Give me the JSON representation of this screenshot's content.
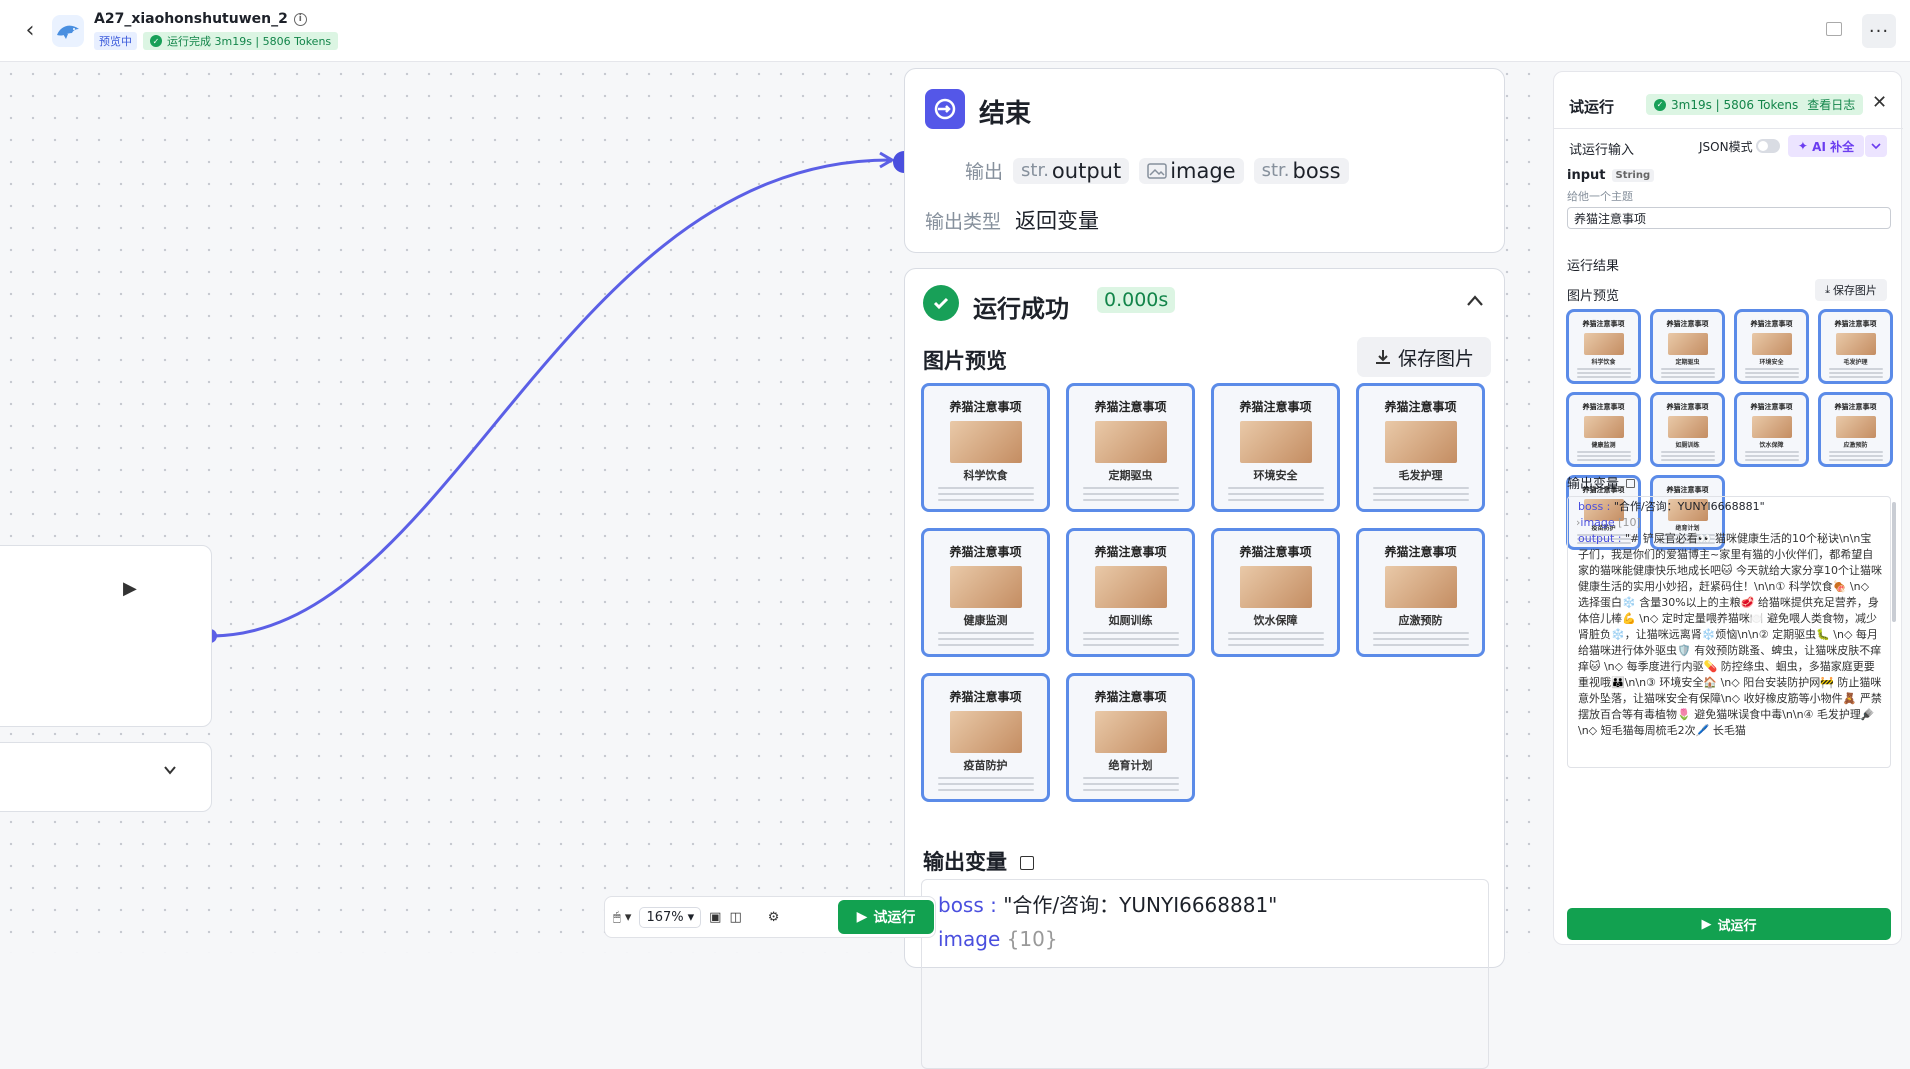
{
  "header": {
    "title": "A27_xiaohonshutuwen_2",
    "badge_preview": "预览中",
    "status": "运行完成 3m19s | 5806 Tokens"
  },
  "end_node": {
    "title": "结束",
    "output_label": "输出",
    "outputs": [
      {
        "type": "str.",
        "name": "output"
      },
      {
        "type": "img",
        "name": "image"
      },
      {
        "type": "str.",
        "name": "boss"
      }
    ],
    "output_type_label": "输出类型",
    "output_type_value": "返回变量"
  },
  "run_node": {
    "title": "运行成功",
    "time": "0.000s",
    "image_preview": "图片预览",
    "save_button": "保存图片",
    "output_vars": "输出变量",
    "boss_key": "boss",
    "boss_value": "\"合作/咨询：YUNYI6668881\"",
    "image_key": "image",
    "image_count": "{10}"
  },
  "images": [
    {
      "title": "养猫注意事项",
      "caption": "科学饮食"
    },
    {
      "title": "养猫注意事项",
      "caption": "定期驱虫"
    },
    {
      "title": "养猫注意事项",
      "caption": "环境安全"
    },
    {
      "title": "养猫注意事项",
      "caption": "毛发护理"
    },
    {
      "title": "养猫注意事项",
      "caption": "健康监测"
    },
    {
      "title": "养猫注意事项",
      "caption": "如厕训练"
    },
    {
      "title": "养猫注意事项",
      "caption": "饮水保障"
    },
    {
      "title": "养猫注意事项",
      "caption": "应激预防"
    },
    {
      "title": "养猫注意事项",
      "caption": "疫苗防护"
    },
    {
      "title": "养猫注意事项",
      "caption": "绝育计划"
    }
  ],
  "toolbar": {
    "zoom": "167%",
    "run": "试运行"
  },
  "panel": {
    "title": "试运行",
    "status": "3m19s | 5806 Tokens",
    "view_log": "查看日志",
    "input_section": "试运行输入",
    "json_mode": "JSON模式",
    "ai_button": "AI 补全",
    "input_name": "input",
    "input_type": "String",
    "input_hint": "给他一个主题",
    "input_value": "养猫注意事项",
    "result_section": "运行结果",
    "image_preview": "图片预览",
    "save_button": "保存图片",
    "output_vars": "输出变量",
    "boss_key": "boss",
    "boss_value": "\"合作/咨询：YUNYI6668881\"",
    "image_key": "image",
    "image_count": "[10]",
    "output_key": "output",
    "output_value": "\"# 铲屎官必看👀 猫咪健康生活的10个秘诀\\n\\n宝子们，我是你们的爱猫博主~家里有猫的小伙伴们，都希望自家的猫咪能健康快乐地成长吧🐱 今天就给大家分享10个让猫咪健康生活的实用小妙招，赶紧码住！\\n\\n① 科学饮食🍖 \\n◇ 选择蛋白❄️ 含量30%以上的主粮🥩 给猫咪提供充足营养，身体倍儿棒💪 \\n◇ 定时定量喂养猫咪🍽️ 避免喂人类食物，减少肾脏负❄️，让猫咪远离肾❄️烦恼\\n\\n② 定期驱虫🐛 \\n◇ 每月给猫咪进行体外驱虫🛡️ 有效预防跳蚤、蜱虫，让猫咪皮肤不痒痒🐱 \\n◇ 每季度进行内驱💊 防控绦虫、蛔虫，多猫家庭更要重视哦👪\\n\\n③ 环境安全🏠 \\n◇ 阳台安装防护网🚧 防止猫咪意外坠落，让猫咪安全有保障\\n◇ 收好橡皮筋等小物件🧸 严禁摆放百合等有毒植物🌷 避免猫咪误食中毒\\n\\n④ 毛发护理🪮 \\n◇ 短毛猫每周梳毛2次🖊️ 长毛猫",
    "run_button": "试运行"
  }
}
